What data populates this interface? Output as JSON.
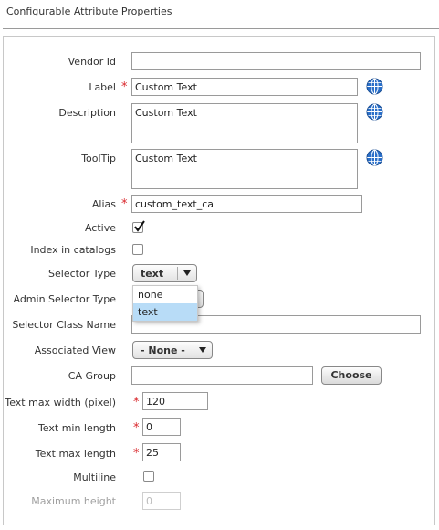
{
  "page": {
    "title": "Configurable Attribute Properties"
  },
  "form": {
    "vendor_id": {
      "label": "Vendor Id",
      "value": ""
    },
    "label": {
      "label": "Label",
      "value": "Custom Text",
      "required_mark": "*"
    },
    "description": {
      "label": "Description",
      "value": "Custom Text"
    },
    "tooltip": {
      "label": "ToolTip",
      "value": "Custom Text"
    },
    "alias": {
      "label": "Alias",
      "value": "custom_text_ca",
      "required_mark": "*"
    },
    "active": {
      "label": "Active",
      "checked": true
    },
    "index_in_catalogs": {
      "label": "Index in catalogs",
      "checked": false
    },
    "selector_type": {
      "label": "Selector Type",
      "value": "text",
      "options": [
        "none",
        "text"
      ],
      "highlighted_option": "text"
    },
    "admin_selector_type": {
      "label": "Admin Selector Type",
      "value": ""
    },
    "selector_class_name": {
      "label": "Selector Class Name",
      "value": ""
    },
    "associated_view": {
      "label": "Associated View",
      "value": "- None -"
    },
    "ca_group": {
      "label": "CA Group",
      "value": "",
      "button": "Choose"
    },
    "text_max_width": {
      "label": "Text max width (pixel)",
      "value": "120",
      "required_mark": "*"
    },
    "text_min_length": {
      "label": "Text min length",
      "value": "0",
      "required_mark": "*"
    },
    "text_max_length": {
      "label": "Text max length",
      "value": "25",
      "required_mark": "*"
    },
    "multiline": {
      "label": "Multiline",
      "checked": false
    },
    "maximum_height": {
      "label": "Maximum height",
      "value": "0",
      "disabled": true
    }
  },
  "icons": {
    "translate": "globe-icon",
    "dropdown_arrow": "chevron-down-icon",
    "check": "checkmark-icon"
  },
  "colors": {
    "required": "#d9262b",
    "highlight": "#b8dcf7",
    "globe": "#2a6fc9"
  }
}
